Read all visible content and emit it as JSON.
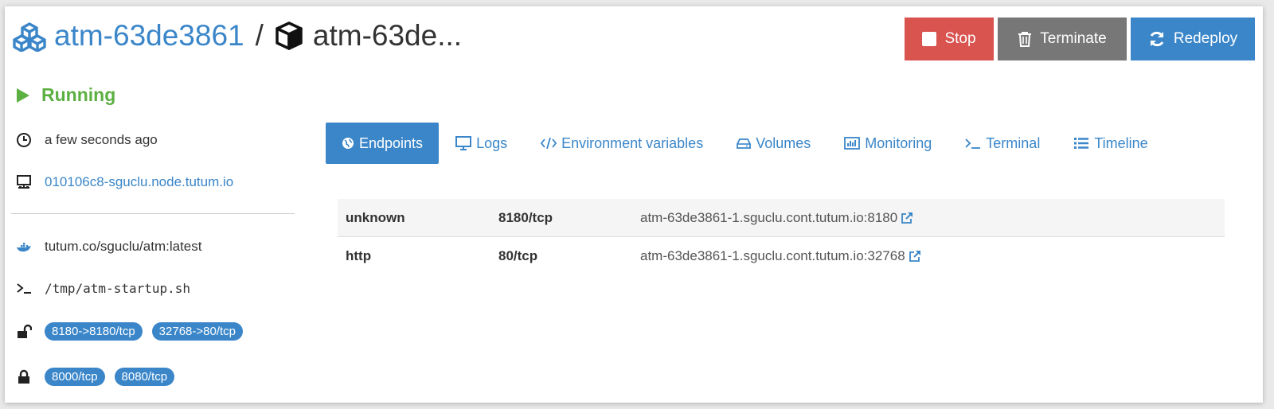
{
  "header": {
    "service_name": "atm-63de3861",
    "separator": "/",
    "container_name": "atm-63de..."
  },
  "actions": {
    "stop_label": "Stop",
    "terminate_label": "Terminate",
    "redeploy_label": "Redeploy"
  },
  "status": {
    "label": "Running"
  },
  "info": {
    "updated": "a few seconds ago",
    "node": "010106c8-sguclu.node.tutum.io",
    "image": "tutum.co/sguclu/atm:latest",
    "command": "/tmp/atm-startup.sh",
    "published_ports": [
      "8180->8180/tcp",
      "32768->80/tcp"
    ],
    "private_ports": [
      "8000/tcp",
      "8080/tcp"
    ]
  },
  "tabs": [
    {
      "label": "Endpoints",
      "icon": "globe-icon",
      "active": true
    },
    {
      "label": "Logs",
      "icon": "monitor-icon"
    },
    {
      "label": "Environment variables",
      "icon": "code-icon"
    },
    {
      "label": "Volumes",
      "icon": "hdd-icon"
    },
    {
      "label": "Monitoring",
      "icon": "bar-chart-icon"
    },
    {
      "label": "Terminal",
      "icon": "terminal-icon"
    },
    {
      "label": "Timeline",
      "icon": "list-icon"
    }
  ],
  "endpoints": [
    {
      "name": "unknown",
      "port": "8180/tcp",
      "url": "atm-63de3861-1.sguclu.cont.tutum.io:8180"
    },
    {
      "name": "http",
      "port": "80/tcp",
      "url": "atm-63de3861-1.sguclu.cont.tutum.io:32768"
    }
  ],
  "colors": {
    "primary": "#3a86c9",
    "danger": "#d9534f",
    "neutral": "#777777",
    "running": "#5cb041"
  }
}
